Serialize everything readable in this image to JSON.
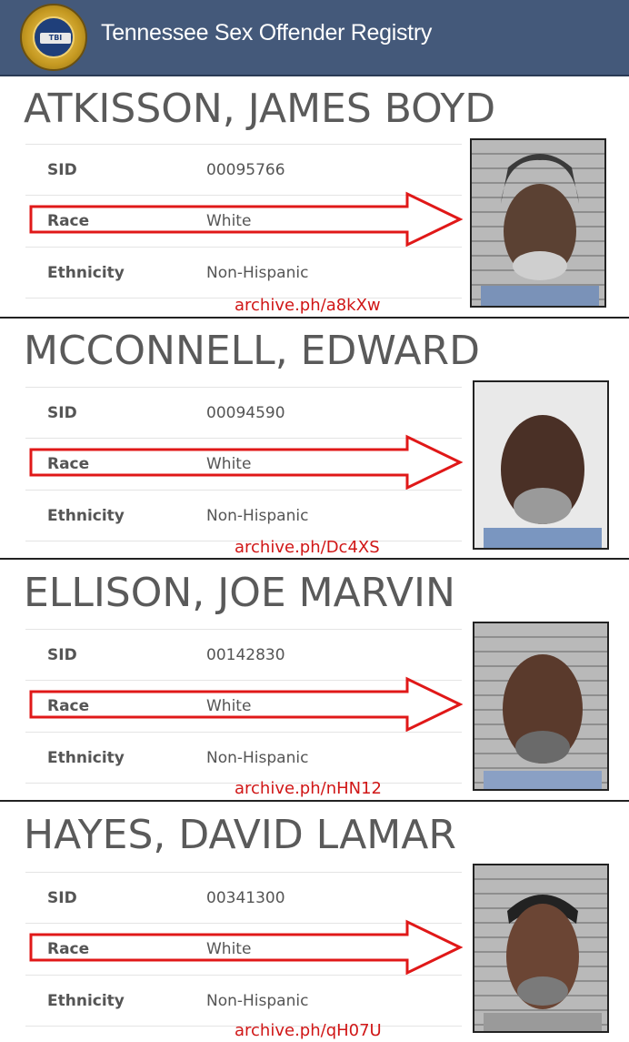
{
  "header": {
    "seal_text": "TBI",
    "title": "Tennessee Sex Offender Registry"
  },
  "labels": {
    "sid": "SID",
    "race": "Race",
    "ethnicity": "Ethnicity"
  },
  "offenders": [
    {
      "name": "ATKISSON, JAMES BOYD",
      "sid": "00095766",
      "race": "White",
      "ethnicity": "Non-Hispanic",
      "archive": "archive.ph/a8kXw"
    },
    {
      "name": "MCCONNELL, EDWARD",
      "sid": "00094590",
      "race": "White",
      "ethnicity": "Non-Hispanic",
      "archive": "archive.ph/Dc4XS"
    },
    {
      "name": "ELLISON, JOE MARVIN",
      "sid": "00142830",
      "race": "White",
      "ethnicity": "Non-Hispanic",
      "archive": "archive.ph/nHN12"
    },
    {
      "name": "HAYES, DAVID LAMAR",
      "sid": "00341300",
      "race": "White",
      "ethnicity": "Non-Hispanic",
      "archive": "archive.ph/qH07U"
    }
  ],
  "colors": {
    "header": "#44597a",
    "arrow": "#e01818",
    "archive_text": "#d01616"
  }
}
